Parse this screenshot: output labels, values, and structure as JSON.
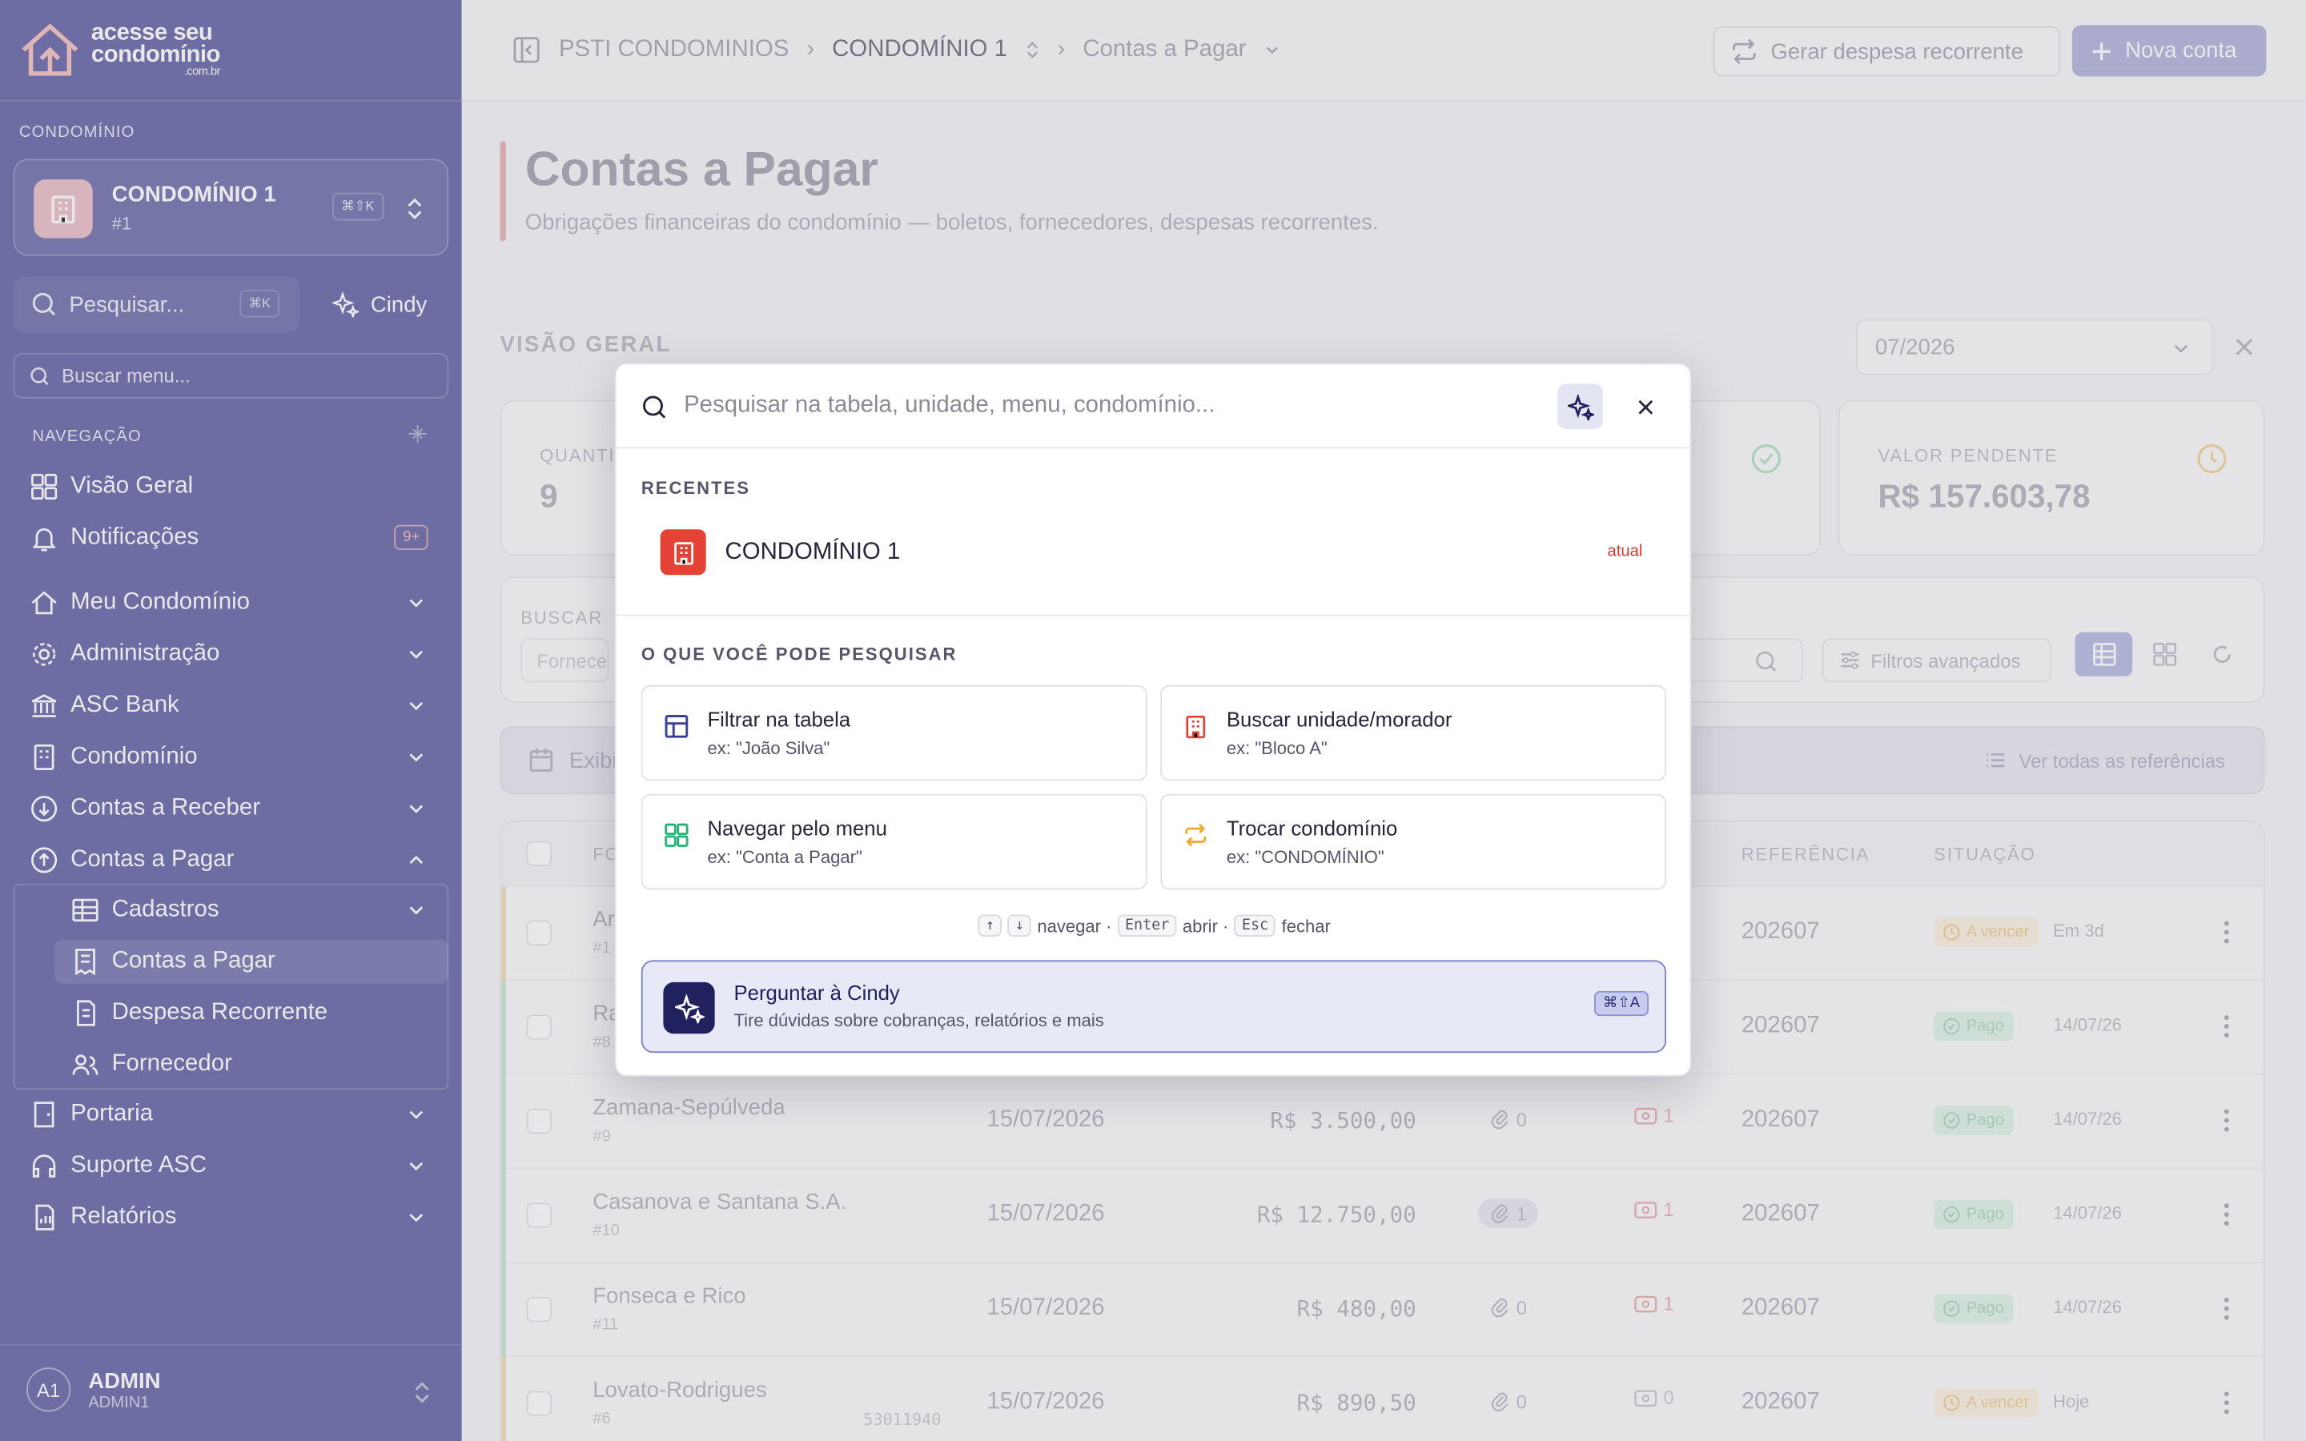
{
  "sidebar": {
    "logo": {
      "line1": "acesse seu",
      "line2": "condomínio",
      "line3": ".com.br"
    },
    "section_condominio": "CONDOMÍNIO",
    "condo": {
      "name": "CONDOMÍNIO 1",
      "id": "#1",
      "shortcut": "⌘⇧K"
    },
    "search": {
      "placeholder": "Pesquisar...",
      "shortcut": "⌘K"
    },
    "cindy_label": "Cindy",
    "menu_search_placeholder": "Buscar menu...",
    "section_nav": "NAVEGAÇÃO",
    "items": [
      {
        "label": "Visão Geral"
      },
      {
        "label": "Notificações",
        "badge": "9+"
      },
      {
        "label": "Meu Condomínio"
      },
      {
        "label": "Administração"
      },
      {
        "label": "ASC Bank"
      },
      {
        "label": "Condomínio"
      },
      {
        "label": "Contas a Receber"
      },
      {
        "label": "Contas a Pagar"
      },
      {
        "label": "Portaria"
      },
      {
        "label": "Suporte ASC"
      },
      {
        "label": "Relatórios"
      }
    ],
    "subitems": [
      {
        "label": "Cadastros"
      },
      {
        "label": "Contas a Pagar"
      },
      {
        "label": "Despesa Recorrente"
      },
      {
        "label": "Fornecedor"
      }
    ],
    "user": {
      "initials": "A1",
      "name": "ADMIN",
      "sub": "ADMIN1"
    }
  },
  "topbar": {
    "crumbs": [
      "PSTI CONDOMINIOS",
      "CONDOMÍNIO 1",
      "Contas a Pagar"
    ],
    "recurring_button": "Gerar despesa recorrente",
    "new_button": "Nova conta"
  },
  "page": {
    "title": "Contas a Pagar",
    "subtitle": "Obrigações financeiras do condomínio — boletos, fornecedores, despesas recorrentes.",
    "overview": "VISÃO GERAL",
    "month": "07/2026",
    "cards": [
      {
        "label": "QUANTI",
        "value": "9"
      },
      {
        "label": "VALOR PENDENTE",
        "value": "R$ 157.603,78"
      }
    ],
    "filter_label": "BUSCAR",
    "filter_placeholder": "Fornece",
    "advanced_filters": "Filtros avançados",
    "info_left": "Exibi",
    "info_right": "Ver todas as referências",
    "columns": {
      "fo": "FO",
      "ref": "REFERÊNCIA",
      "sit": "SITUAÇÃO"
    },
    "rows": [
      {
        "name": "Ar",
        "num": "#1",
        "doc": "",
        "date": "",
        "amount": "",
        "att": "",
        "bol": "",
        "ref": "202607",
        "status": "A vencer",
        "when": "Em 3d",
        "strip": "#f2d9a8"
      },
      {
        "name": "Ra",
        "num": "#8",
        "doc": "",
        "date": "",
        "amount": "",
        "att": "",
        "bol": "",
        "ref": "202607",
        "status": "Pago",
        "when": "14/07/26",
        "strip": "#b9e6c8"
      },
      {
        "name": "Zamana-Sepúlveda",
        "num": "#9",
        "doc": "",
        "date": "15/07/2026",
        "amount": "R$ 3.500,00",
        "att": "0",
        "bol": "1",
        "ref": "202607",
        "status": "Pago",
        "when": "14/07/26",
        "strip": "#b9e6c8"
      },
      {
        "name": "Casanova e Santana S.A.",
        "num": "#10",
        "doc": "",
        "date": "15/07/2026",
        "amount": "R$ 12.750,00",
        "att": "1",
        "bol": "1",
        "ref": "202607",
        "status": "Pago",
        "when": "14/07/26",
        "strip": "#b9e6c8"
      },
      {
        "name": "Fonseca e Rico",
        "num": "#11",
        "doc": "",
        "date": "15/07/2026",
        "amount": "R$ 480,00",
        "att": "0",
        "bol": "1",
        "ref": "202607",
        "status": "Pago",
        "when": "14/07/26",
        "strip": "#b9e6c8"
      },
      {
        "name": "Lovato-Rodrigues",
        "num": "#6",
        "doc": "53011940",
        "date": "15/07/2026",
        "amount": "R$ 890,50",
        "att": "0",
        "bol": "0",
        "ref": "202607",
        "status": "A vencer",
        "when": "Hoje",
        "strip": "#f2d9a8"
      }
    ]
  },
  "modal": {
    "search_placeholder": "Pesquisar na tabela, unidade, menu, condomínio...",
    "recent_title": "RECENTES",
    "recent": {
      "name": "CONDOMÍNIO 1",
      "tag": "atual"
    },
    "what_title": "O QUE VOCÊ PODE PESQUISAR",
    "options": [
      {
        "title": "Filtrar na tabela",
        "example": "ex: \"João Silva\""
      },
      {
        "title": "Buscar unidade/morador",
        "example": "ex: \"Bloco A\""
      },
      {
        "title": "Navegar pelo menu",
        "example": "ex: \"Conta a Pagar\""
      },
      {
        "title": "Trocar condomínio",
        "example": "ex: \"CONDOMÍNIO\""
      }
    ],
    "hint": {
      "k_up": "↑",
      "k_down": "↓",
      "navigate": "navegar ·",
      "k_enter": "Enter",
      "open": "abrir ·",
      "k_esc": "Esc",
      "close": "fechar"
    },
    "ask": {
      "title": "Perguntar à Cindy",
      "subtitle": "Tire dúvidas sobre cobranças, relatórios e mais",
      "shortcut": "⌘⇧A"
    }
  },
  "colors": {
    "sidebar": "#4f4f9a",
    "brand_red": "#e44236",
    "navy": "#20215e",
    "accent": "#7b7fd0"
  }
}
